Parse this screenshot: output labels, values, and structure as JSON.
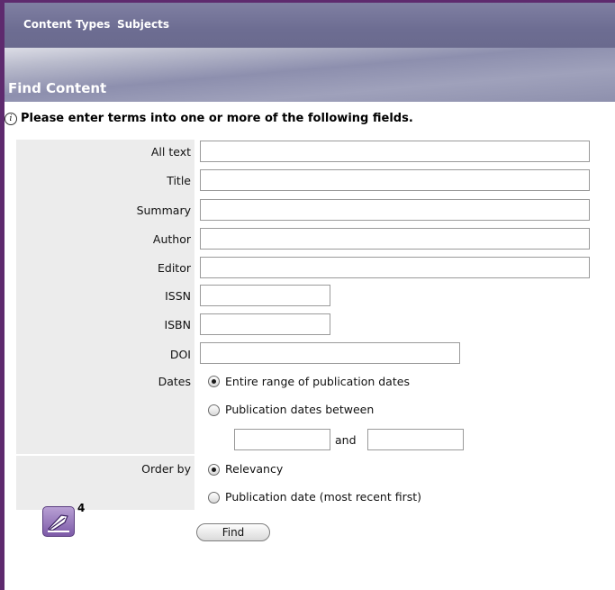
{
  "nav": {
    "tabs": [
      "Content Types",
      "Subjects"
    ]
  },
  "section": {
    "title": "Find Content"
  },
  "instruction": "Please enter terms into one or more of the following fields.",
  "fields": [
    {
      "label": "All text",
      "value": ""
    },
    {
      "label": "Title",
      "value": ""
    },
    {
      "label": "Summary",
      "value": ""
    },
    {
      "label": "Author",
      "value": ""
    },
    {
      "label": "Editor",
      "value": ""
    },
    {
      "label": "ISSN",
      "value": ""
    },
    {
      "label": "ISBN",
      "value": ""
    },
    {
      "label": "DOI",
      "value": ""
    }
  ],
  "dates": {
    "label": "Dates",
    "options": [
      "Entire range of publication dates",
      "Publication dates between"
    ],
    "selected": "Entire range of publication dates",
    "and_label": "and",
    "from_value": "",
    "to_value": ""
  },
  "order_by": {
    "label": "Order by",
    "options": [
      "Relevancy",
      "Publication date (most recent first)"
    ],
    "selected": "Relevancy"
  },
  "find_button": "Find",
  "badge": {
    "icon": "edit-note-icon",
    "count": "4"
  },
  "colors": {
    "frame": "#5e2a6e",
    "header": "#6d6d92",
    "label_bg": "#ececec"
  }
}
